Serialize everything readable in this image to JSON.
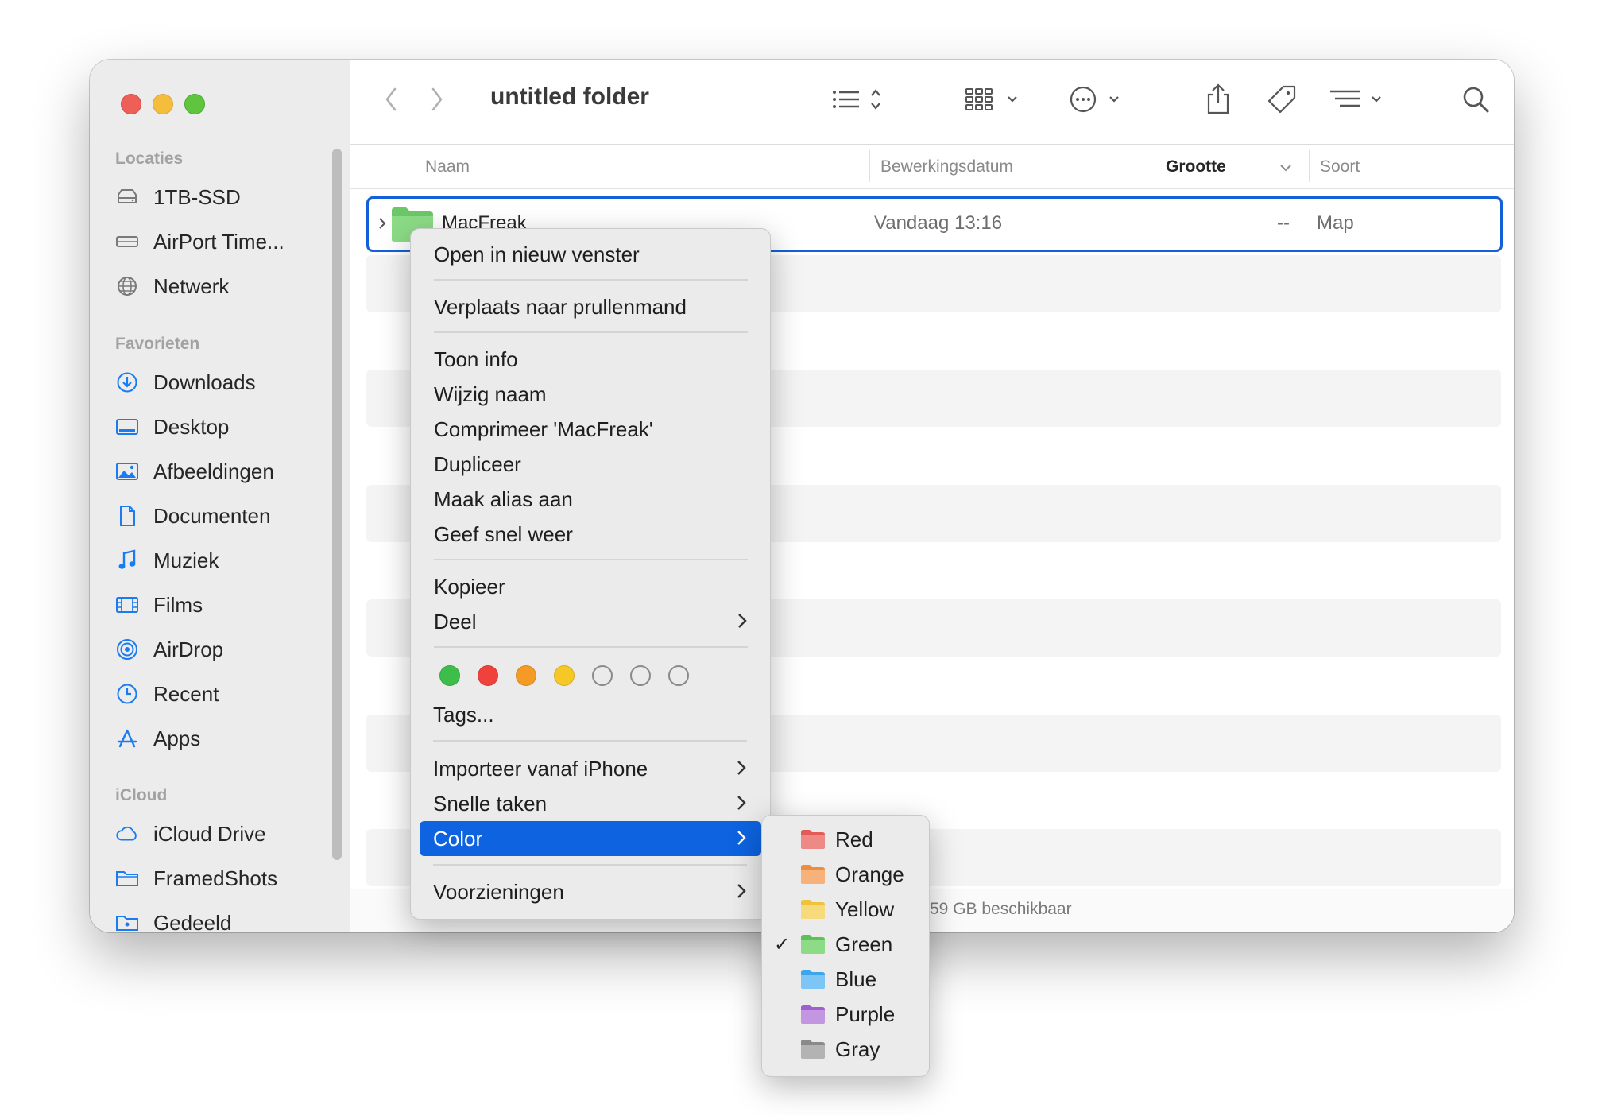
{
  "window": {
    "title": "untitled folder"
  },
  "sidebar": {
    "sections": [
      {
        "label": "Locaties",
        "items": [
          {
            "label": "1TB-SSD",
            "icon": "drive-icon"
          },
          {
            "label": "AirPort Time...",
            "icon": "airport-drive-icon"
          },
          {
            "label": "Netwerk",
            "icon": "globe-icon"
          }
        ]
      },
      {
        "label": "Favorieten",
        "items": [
          {
            "label": "Downloads",
            "icon": "download-icon"
          },
          {
            "label": "Desktop",
            "icon": "desktop-icon"
          },
          {
            "label": "Afbeeldingen",
            "icon": "photo-icon"
          },
          {
            "label": "Documenten",
            "icon": "document-icon"
          },
          {
            "label": "Muziek",
            "icon": "music-note-icon"
          },
          {
            "label": "Films",
            "icon": "film-icon"
          },
          {
            "label": "AirDrop",
            "icon": "airdrop-icon"
          },
          {
            "label": "Recent",
            "icon": "clock-icon"
          },
          {
            "label": "Apps",
            "icon": "apps-icon"
          }
        ]
      },
      {
        "label": "iCloud",
        "items": [
          {
            "label": "iCloud Drive",
            "icon": "cloud-icon"
          },
          {
            "label": "FramedShots",
            "icon": "folder-icon"
          },
          {
            "label": "Gedeeld",
            "icon": "shared-folder-icon"
          }
        ]
      }
    ]
  },
  "columns": {
    "name": "Naam",
    "modified": "Bewerkingsdatum",
    "size": "Grootte",
    "kind": "Soort"
  },
  "file": {
    "name": "MacFreak",
    "modified": "Vandaag 13:16",
    "size": "--",
    "kind": "Map"
  },
  "status": {
    "text": "59 GB beschikbaar"
  },
  "context_menu": {
    "open_new_window": "Open in nieuw venster",
    "move_to_trash": "Verplaats naar prullenmand",
    "get_info": "Toon info",
    "rename": "Wijzig naam",
    "compress": "Comprimeer 'MacFreak'",
    "duplicate": "Dupliceer",
    "make_alias": "Maak alias aan",
    "quick_look": "Geef snel weer",
    "copy": "Kopieer",
    "share": "Deel",
    "tags": "Tags...",
    "import_iphone": "Importeer vanaf iPhone",
    "quick_actions": "Snelle taken",
    "color": "Color",
    "services": "Voorzieningen",
    "tag_colors": [
      "#3dbe4a",
      "#f0423c",
      "#f59a25",
      "#f5c727",
      "none",
      "none",
      "none"
    ]
  },
  "color_submenu": {
    "items": [
      {
        "label": "Red",
        "color": "#e35a57",
        "checked": false
      },
      {
        "label": "Orange",
        "color": "#f3a154",
        "checked": false
      },
      {
        "label": "Yellow",
        "color": "#f4cf5a",
        "checked": false
      },
      {
        "label": "Green",
        "color": "#6fcf6a",
        "checked": true
      },
      {
        "label": "Blue",
        "color": "#5cb6f2",
        "checked": false
      },
      {
        "label": "Purple",
        "color": "#b07ad6",
        "checked": false
      },
      {
        "label": "Gray",
        "color": "#9a9a9a",
        "checked": false
      }
    ],
    "check_mark": "✓"
  },
  "colors": {
    "accent": "#0d63e0",
    "folder_green": "#7fd67a"
  }
}
